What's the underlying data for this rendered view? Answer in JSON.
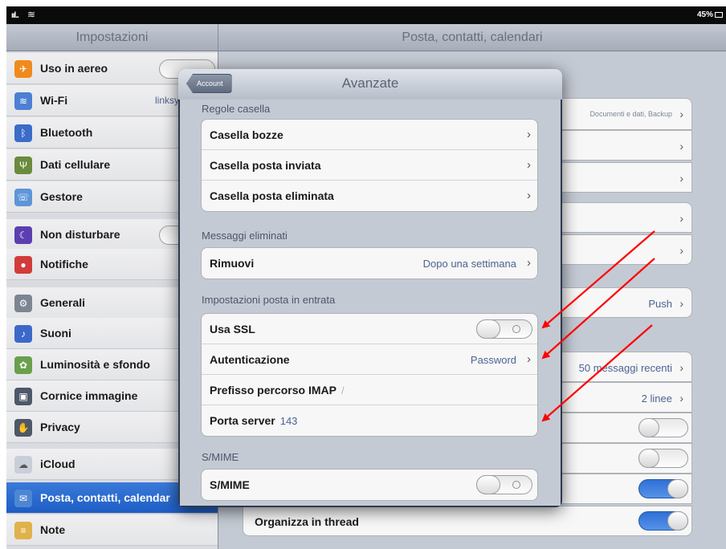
{
  "status_bar": {
    "signal": "ııl..",
    "wifi_icon": "wifi-icon",
    "battery": "45%"
  },
  "sidebar": {
    "title": "Impostazioni",
    "items": [
      {
        "label": "Uso in aereo",
        "icon": "airplane-icon",
        "color": "#f08a1c",
        "toggle": true
      },
      {
        "label": "Wi-Fi",
        "icon": "wifi-icon",
        "color": "#4d7fd4",
        "value": "linksy"
      },
      {
        "label": "Bluetooth",
        "icon": "bluetooth-icon",
        "color": "#3a6cc8"
      },
      {
        "label": "Dati cellulare",
        "icon": "antenna-icon",
        "color": "#6a8b3e"
      },
      {
        "label": "Gestore",
        "icon": "phone-icon",
        "color": "#5e95d8"
      },
      {
        "label": "Non disturbare",
        "icon": "moon-icon",
        "color": "#5b3fb0",
        "toggle": true
      },
      {
        "label": "Notifiche",
        "icon": "notification-icon",
        "color": "#d33b3b"
      },
      {
        "label": "Generali",
        "icon": "gear-icon",
        "color": "#7c8591"
      },
      {
        "label": "Suoni",
        "icon": "speaker-icon",
        "color": "#3c69c9"
      },
      {
        "label": "Luminosità e sfondo",
        "icon": "flower-icon",
        "color": "#6aa04c"
      },
      {
        "label": "Cornice immagine",
        "icon": "frame-icon",
        "color": "#4d5868"
      },
      {
        "label": "Privacy",
        "icon": "hand-icon",
        "color": "#4d5868"
      },
      {
        "label": "iCloud",
        "icon": "cloud-icon",
        "color": "#c9cfd8"
      },
      {
        "label": "Posta, contatti, calendar",
        "icon": "mail-icon",
        "color": "#4d87d4",
        "selected": true
      },
      {
        "label": "Note",
        "icon": "notes-icon",
        "color": "#e0b24a"
      }
    ]
  },
  "main": {
    "title": "Posta, contatti, calendari",
    "rows": [
      {
        "value": "Documenti e dati, Backup"
      },
      {
        "value": "Push"
      },
      {
        "value": "50 messaggi recenti"
      },
      {
        "value": "2 linee"
      },
      {
        "label": "Organizza in thread"
      }
    ]
  },
  "popover": {
    "back_label": "Account",
    "title": "Avanzate",
    "sections": {
      "mailbox": {
        "title": "Regole casella",
        "items": [
          "Casella bozze",
          "Casella posta inviata",
          "Casella posta eliminata"
        ]
      },
      "deleted": {
        "title": "Messaggi eliminati",
        "remove_label": "Rimuovi",
        "remove_value": "Dopo una settimana"
      },
      "incoming": {
        "title": "Impostazioni posta in entrata",
        "ssl_label": "Usa SSL",
        "auth_label": "Autenticazione",
        "auth_value": "Password",
        "imap_label": "Prefisso percorso IMAP",
        "imap_value": "/",
        "port_label": "Porta server",
        "port_value": "143"
      },
      "smime": {
        "title": "S/MIME",
        "label": "S/MIME"
      }
    }
  },
  "annotations": {
    "arrow_color": "#ff0000"
  }
}
